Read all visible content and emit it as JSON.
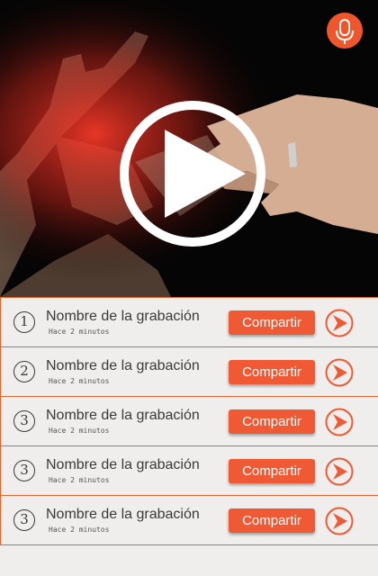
{
  "hero": {
    "mic_icon": "microphone-icon",
    "play_icon": "play-icon",
    "accent": "#f0562b"
  },
  "recordings": [
    {
      "number": "1",
      "title": "Nombre de la grabación",
      "time": "Hace 2 minutos",
      "share_label": "Compartir"
    },
    {
      "number": "2",
      "title": "Nombre de la grabación",
      "time": "Hace 2 minutos",
      "share_label": "Compartir"
    },
    {
      "number": "3",
      "title": "Nombre de la grabación",
      "time": "Hace 2 minutos",
      "share_label": "Compartir"
    },
    {
      "number": "3",
      "title": "Nombre de la grabación",
      "time": "Hace 2 minutos",
      "share_label": "Compartir"
    },
    {
      "number": "3",
      "title": "Nombre de la grabación",
      "time": "Hace 2 minutos",
      "share_label": "Compartir"
    }
  ],
  "colors": {
    "accent": "#ef5a35",
    "divider": "#e2652f",
    "background": "#efeeec"
  }
}
